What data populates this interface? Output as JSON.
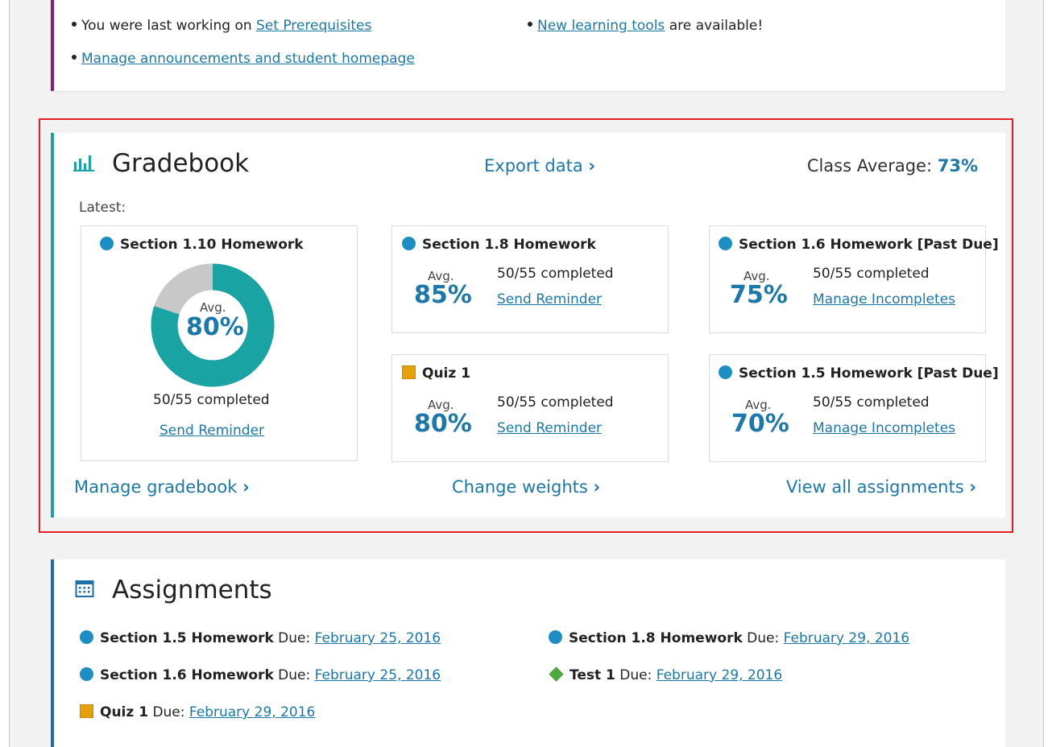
{
  "announcements": {
    "last_working_prefix": "You were last working on",
    "last_working_link": "Set Prerequisites",
    "new_tools_link": "New learning tools",
    "new_tools_suffix": "are available!",
    "manage_link": "Manage announcements and student homepage"
  },
  "gradebook": {
    "title": "Gradebook",
    "export_label": "Export data",
    "class_average_label": "Class Average:",
    "class_average_value": "73%",
    "latest_label": "Latest:",
    "featured": {
      "title": "Section 1.10 Homework",
      "avg_label": "Avg.",
      "avg_value": "80%",
      "avg_fraction": 0.8,
      "completed": "50/55 completed",
      "action": "Send Reminder"
    },
    "tiles": [
      {
        "title": "Section 1.8 Homework",
        "avg_label": "Avg.",
        "avg_value": "85%",
        "completed": "50/55 completed",
        "action": "Send Reminder",
        "marker": "circle"
      },
      {
        "title": "Section 1.6 Homework [Past Due]",
        "avg_label": "Avg.",
        "avg_value": "75%",
        "completed": "50/55 completed",
        "action": "Manage Incompletes",
        "marker": "circle"
      },
      {
        "title": "Quiz 1",
        "avg_label": "Avg.",
        "avg_value": "80%",
        "completed": "50/55 completed",
        "action": "Send Reminder",
        "marker": "square"
      },
      {
        "title": "Section 1.5 Homework [Past Due]",
        "avg_label": "Avg.",
        "avg_value": "70%",
        "completed": "50/55 completed",
        "action": "Manage Incompletes",
        "marker": "circle"
      }
    ],
    "manage_label": "Manage gradebook",
    "weights_label": "Change weights",
    "view_all_label": "View all assignments"
  },
  "assignments": {
    "title": "Assignments",
    "due_label": "Due:",
    "items": [
      {
        "name": "Section 1.5 Homework",
        "due": "February 25, 2016",
        "marker": "circle"
      },
      {
        "name": "Section 1.8 Homework",
        "due": "February 29, 2016",
        "marker": "circle"
      },
      {
        "name": "Section 1.6 Homework",
        "due": "February 25, 2016",
        "marker": "circle"
      },
      {
        "name": "Test 1",
        "due": "February 29, 2016",
        "marker": "diamond"
      },
      {
        "name": "Quiz 1",
        "due": "February 29, 2016",
        "marker": "square"
      }
    ]
  },
  "colors": {
    "accent_link": "#1b78a8",
    "gradebook_border": "#1aa3a3",
    "announcement_border": "#8e1a7a",
    "highlight": "#e02020",
    "donut_fill": "#1aa3a3",
    "donut_remaining": "#c8c8c8",
    "quiz_marker": "#e5a10c",
    "test_marker": "#4aa83c",
    "homework_marker": "#1b8fc4"
  }
}
